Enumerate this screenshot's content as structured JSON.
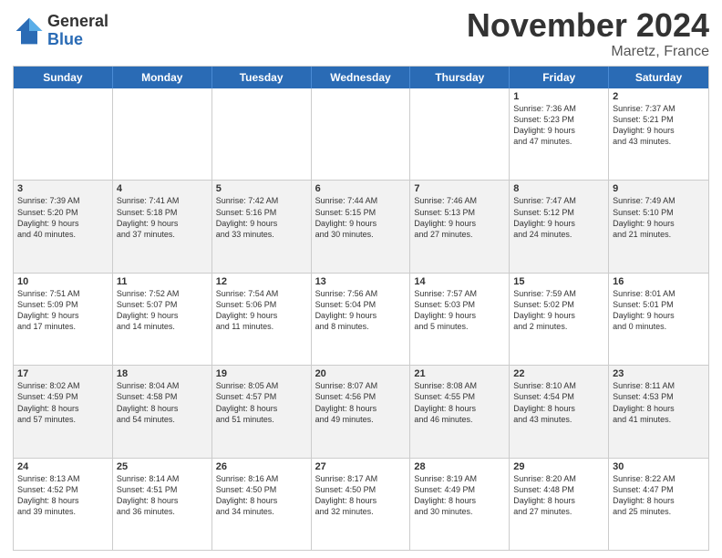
{
  "logo": {
    "general": "General",
    "blue": "Blue"
  },
  "title": "November 2024",
  "location": "Maretz, France",
  "header_days": [
    "Sunday",
    "Monday",
    "Tuesday",
    "Wednesday",
    "Thursday",
    "Friday",
    "Saturday"
  ],
  "rows": [
    [
      {
        "day": "",
        "text": ""
      },
      {
        "day": "",
        "text": ""
      },
      {
        "day": "",
        "text": ""
      },
      {
        "day": "",
        "text": ""
      },
      {
        "day": "",
        "text": ""
      },
      {
        "day": "1",
        "text": "Sunrise: 7:36 AM\nSunset: 5:23 PM\nDaylight: 9 hours\nand 47 minutes."
      },
      {
        "day": "2",
        "text": "Sunrise: 7:37 AM\nSunset: 5:21 PM\nDaylight: 9 hours\nand 43 minutes."
      }
    ],
    [
      {
        "day": "3",
        "text": "Sunrise: 7:39 AM\nSunset: 5:20 PM\nDaylight: 9 hours\nand 40 minutes."
      },
      {
        "day": "4",
        "text": "Sunrise: 7:41 AM\nSunset: 5:18 PM\nDaylight: 9 hours\nand 37 minutes."
      },
      {
        "day": "5",
        "text": "Sunrise: 7:42 AM\nSunset: 5:16 PM\nDaylight: 9 hours\nand 33 minutes."
      },
      {
        "day": "6",
        "text": "Sunrise: 7:44 AM\nSunset: 5:15 PM\nDaylight: 9 hours\nand 30 minutes."
      },
      {
        "day": "7",
        "text": "Sunrise: 7:46 AM\nSunset: 5:13 PM\nDaylight: 9 hours\nand 27 minutes."
      },
      {
        "day": "8",
        "text": "Sunrise: 7:47 AM\nSunset: 5:12 PM\nDaylight: 9 hours\nand 24 minutes."
      },
      {
        "day": "9",
        "text": "Sunrise: 7:49 AM\nSunset: 5:10 PM\nDaylight: 9 hours\nand 21 minutes."
      }
    ],
    [
      {
        "day": "10",
        "text": "Sunrise: 7:51 AM\nSunset: 5:09 PM\nDaylight: 9 hours\nand 17 minutes."
      },
      {
        "day": "11",
        "text": "Sunrise: 7:52 AM\nSunset: 5:07 PM\nDaylight: 9 hours\nand 14 minutes."
      },
      {
        "day": "12",
        "text": "Sunrise: 7:54 AM\nSunset: 5:06 PM\nDaylight: 9 hours\nand 11 minutes."
      },
      {
        "day": "13",
        "text": "Sunrise: 7:56 AM\nSunset: 5:04 PM\nDaylight: 9 hours\nand 8 minutes."
      },
      {
        "day": "14",
        "text": "Sunrise: 7:57 AM\nSunset: 5:03 PM\nDaylight: 9 hours\nand 5 minutes."
      },
      {
        "day": "15",
        "text": "Sunrise: 7:59 AM\nSunset: 5:02 PM\nDaylight: 9 hours\nand 2 minutes."
      },
      {
        "day": "16",
        "text": "Sunrise: 8:01 AM\nSunset: 5:01 PM\nDaylight: 9 hours\nand 0 minutes."
      }
    ],
    [
      {
        "day": "17",
        "text": "Sunrise: 8:02 AM\nSunset: 4:59 PM\nDaylight: 8 hours\nand 57 minutes."
      },
      {
        "day": "18",
        "text": "Sunrise: 8:04 AM\nSunset: 4:58 PM\nDaylight: 8 hours\nand 54 minutes."
      },
      {
        "day": "19",
        "text": "Sunrise: 8:05 AM\nSunset: 4:57 PM\nDaylight: 8 hours\nand 51 minutes."
      },
      {
        "day": "20",
        "text": "Sunrise: 8:07 AM\nSunset: 4:56 PM\nDaylight: 8 hours\nand 49 minutes."
      },
      {
        "day": "21",
        "text": "Sunrise: 8:08 AM\nSunset: 4:55 PM\nDaylight: 8 hours\nand 46 minutes."
      },
      {
        "day": "22",
        "text": "Sunrise: 8:10 AM\nSunset: 4:54 PM\nDaylight: 8 hours\nand 43 minutes."
      },
      {
        "day": "23",
        "text": "Sunrise: 8:11 AM\nSunset: 4:53 PM\nDaylight: 8 hours\nand 41 minutes."
      }
    ],
    [
      {
        "day": "24",
        "text": "Sunrise: 8:13 AM\nSunset: 4:52 PM\nDaylight: 8 hours\nand 39 minutes."
      },
      {
        "day": "25",
        "text": "Sunrise: 8:14 AM\nSunset: 4:51 PM\nDaylight: 8 hours\nand 36 minutes."
      },
      {
        "day": "26",
        "text": "Sunrise: 8:16 AM\nSunset: 4:50 PM\nDaylight: 8 hours\nand 34 minutes."
      },
      {
        "day": "27",
        "text": "Sunrise: 8:17 AM\nSunset: 4:50 PM\nDaylight: 8 hours\nand 32 minutes."
      },
      {
        "day": "28",
        "text": "Sunrise: 8:19 AM\nSunset: 4:49 PM\nDaylight: 8 hours\nand 30 minutes."
      },
      {
        "day": "29",
        "text": "Sunrise: 8:20 AM\nSunset: 4:48 PM\nDaylight: 8 hours\nand 27 minutes."
      },
      {
        "day": "30",
        "text": "Sunrise: 8:22 AM\nSunset: 4:47 PM\nDaylight: 8 hours\nand 25 minutes."
      }
    ]
  ]
}
